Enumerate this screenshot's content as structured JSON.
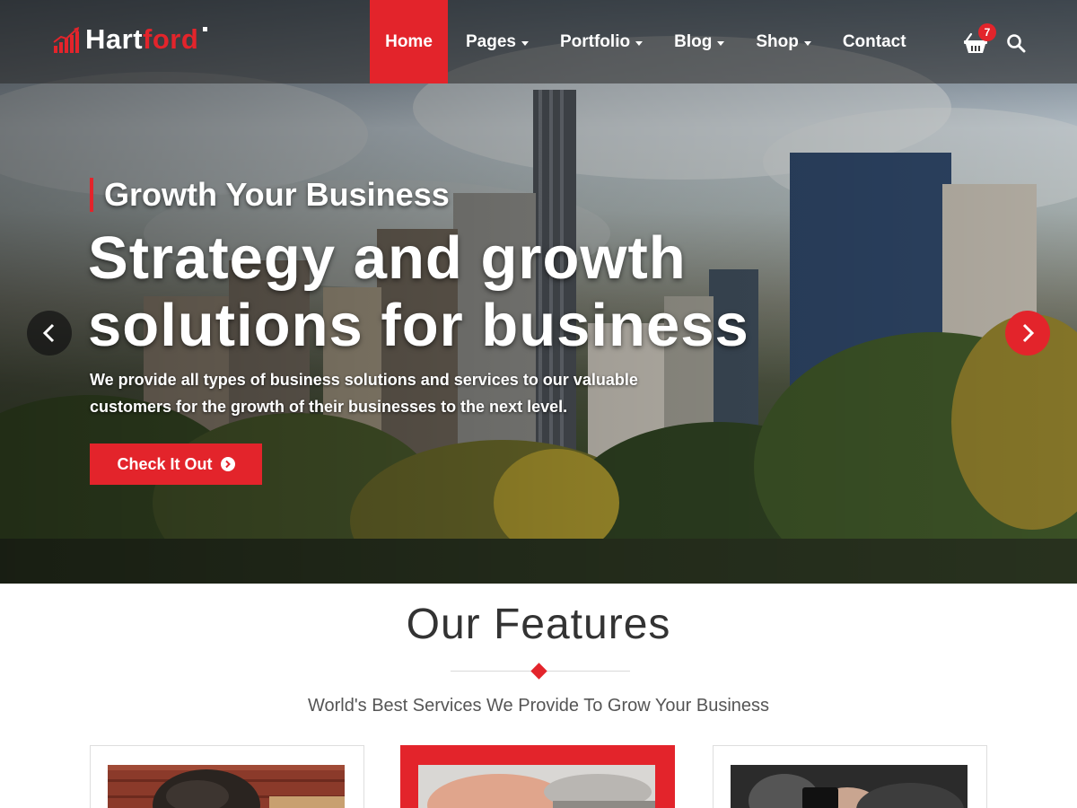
{
  "brand": {
    "name_part1": "Hart",
    "name_part2": "ford"
  },
  "nav": {
    "items": [
      {
        "label": "Home",
        "dropdown": false,
        "active": true
      },
      {
        "label": "Pages",
        "dropdown": true,
        "active": false
      },
      {
        "label": "Portfolio",
        "dropdown": true,
        "active": false
      },
      {
        "label": "Blog",
        "dropdown": true,
        "active": false
      },
      {
        "label": "Shop",
        "dropdown": true,
        "active": false
      },
      {
        "label": "Contact",
        "dropdown": false,
        "active": false
      }
    ],
    "cart_count": "7",
    "cart_icon": "shopping-basket-icon",
    "search_icon": "search-icon"
  },
  "slide": {
    "subtitle": "Growth Your Business",
    "title_line1": "Strategy and growth",
    "title_line2": "solutions for business",
    "description": "We provide all types of business solutions and services to our valuable customers for the growth of their businesses to the next level.",
    "cta_label": "Check It Out",
    "prev_icon": "chevron-left-icon",
    "next_icon": "chevron-right-icon"
  },
  "features": {
    "title": "Our Features",
    "subtitle": "World's Best Services We Provide To Grow Your Business"
  },
  "colors": {
    "accent": "#e3242b",
    "heading": "#333333",
    "text": "#555555"
  }
}
